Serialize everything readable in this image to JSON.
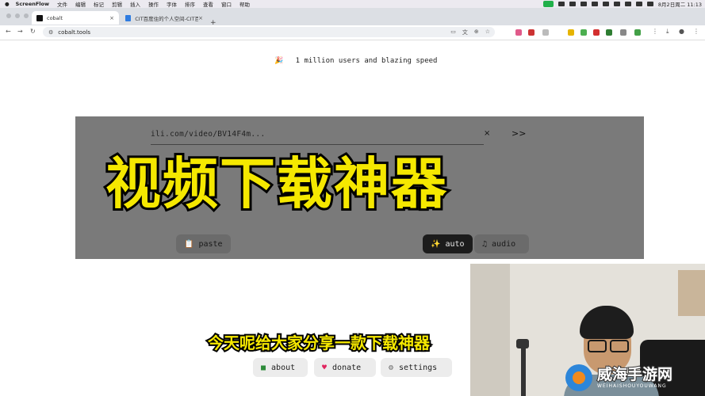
{
  "menubar": {
    "app": "ScreenFlow",
    "items": [
      "文件",
      "编辑",
      "标记",
      "剪辑",
      "插入",
      "操作",
      "字体",
      "排序",
      "查看",
      "窗口",
      "帮助"
    ],
    "clock": "8月2日周二 11:13"
  },
  "tabs": [
    {
      "title": "cobalt",
      "close": "×"
    },
    {
      "title": "CIT百度住的个人空间-CIT百问",
      "close": "×"
    }
  ],
  "new_tab": "+",
  "address_bar": {
    "url": "cobalt.tools"
  },
  "page": {
    "headline_emoji": "🎉",
    "headline": "1 million users and blazing speed",
    "input_value": "ili.com/video/BV14F4m...",
    "clear_icon": "×",
    "submit_icon": ">>",
    "paste_label": "paste",
    "auto_label": "auto",
    "audio_label": "audio",
    "footer": {
      "about_label": "about",
      "donate_label": "donate",
      "settings_label": "settings"
    }
  },
  "overlay": {
    "title": "视频下载神器",
    "subtitle": "今天呢给大家分享一款下载神器"
  },
  "watermark": {
    "name": "威海手游网",
    "latin": "WEIHAISHOUYOUWANG"
  },
  "colors": {
    "overlay_text": "#f5e800",
    "panel_gray": "#7a7a7a",
    "auto_button": "#1c1c1c"
  }
}
